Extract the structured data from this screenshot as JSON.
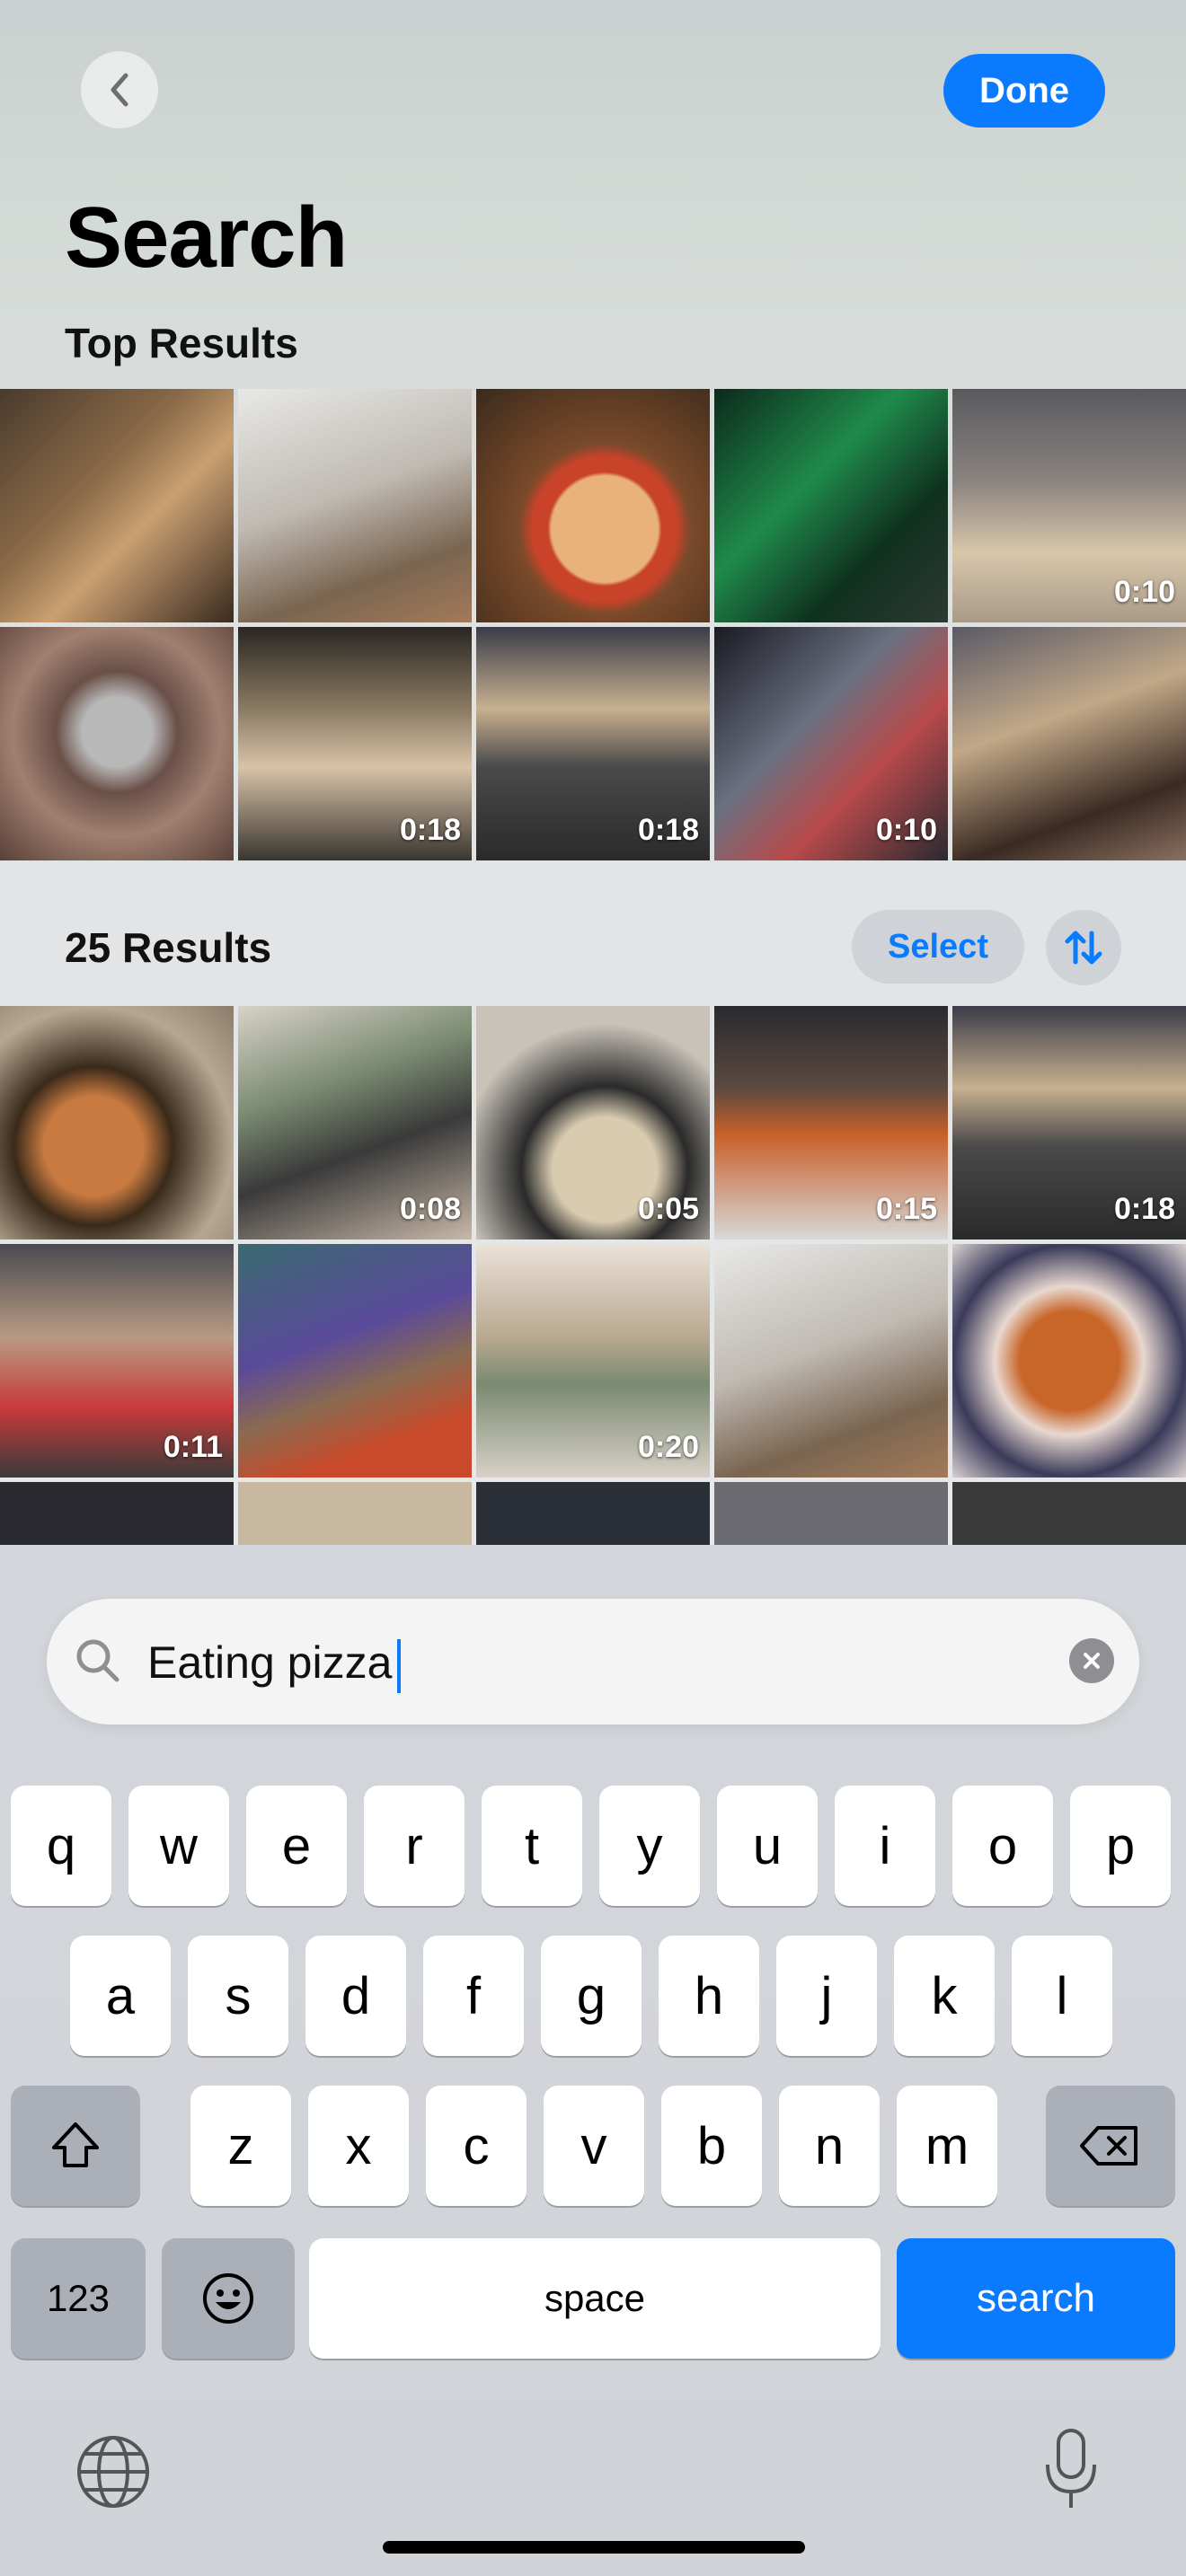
{
  "header": {
    "done_label": "Done",
    "title": "Search",
    "top_results_label": "Top Results"
  },
  "top_results": [
    {
      "duration": ""
    },
    {
      "duration": ""
    },
    {
      "duration": ""
    },
    {
      "duration": ""
    },
    {
      "duration": "0:10"
    },
    {
      "duration": ""
    },
    {
      "duration": "0:18"
    },
    {
      "duration": "0:18"
    },
    {
      "duration": "0:10"
    },
    {
      "duration": ""
    }
  ],
  "results": {
    "count_label": "25 Results",
    "select_label": "Select",
    "items": [
      {
        "duration": ""
      },
      {
        "duration": "0:08"
      },
      {
        "duration": "0:05"
      },
      {
        "duration": "0:15"
      },
      {
        "duration": "0:18"
      },
      {
        "duration": "0:11"
      },
      {
        "duration": ""
      },
      {
        "duration": "0:20"
      },
      {
        "duration": ""
      },
      {
        "duration": ""
      }
    ]
  },
  "search": {
    "query": "Eating pizza"
  },
  "keyboard": {
    "row1": [
      "q",
      "w",
      "e",
      "r",
      "t",
      "y",
      "u",
      "i",
      "o",
      "p"
    ],
    "row2": [
      "a",
      "s",
      "d",
      "f",
      "g",
      "h",
      "j",
      "k",
      "l"
    ],
    "row3": [
      "z",
      "x",
      "c",
      "v",
      "b",
      "n",
      "m"
    ],
    "numbers_label": "123",
    "space_label": "space",
    "search_label": "search"
  },
  "colors": {
    "accent": "#0a7aff"
  }
}
